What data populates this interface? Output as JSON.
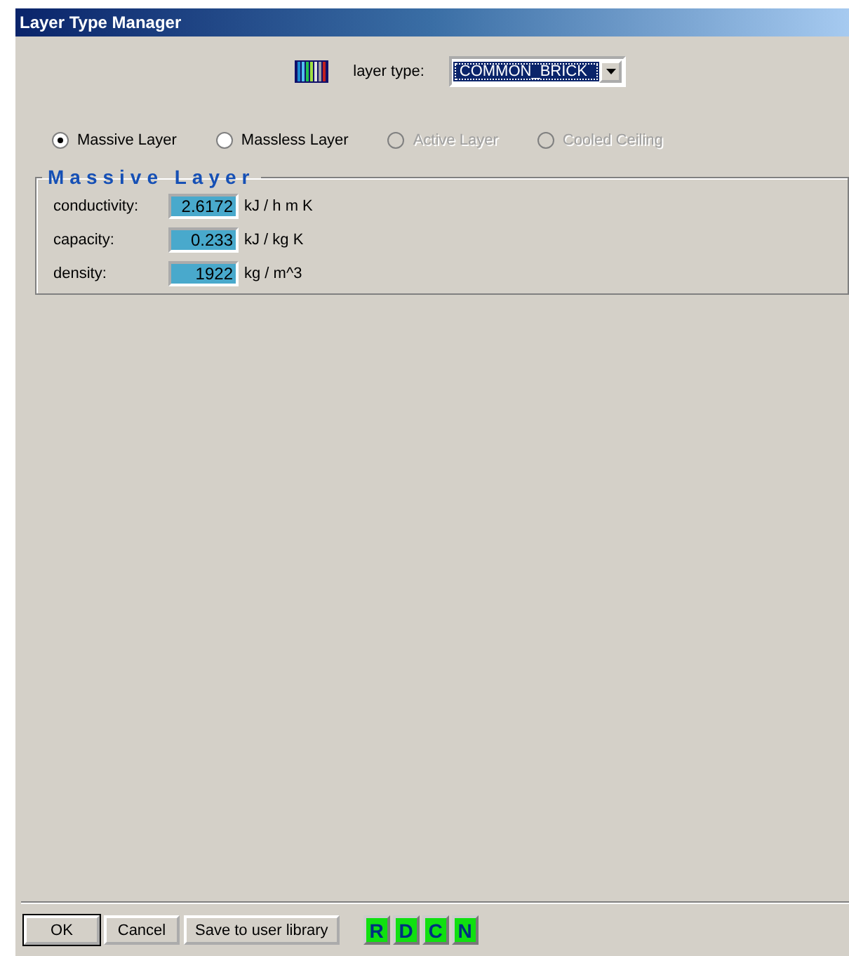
{
  "window": {
    "title": "Layer Type Manager"
  },
  "layer_type": {
    "label": "layer type:",
    "value": "COMMON_BRICK"
  },
  "radios": [
    {
      "label": "Massive Layer",
      "selected": true,
      "disabled": false
    },
    {
      "label": "Massless Layer",
      "selected": false,
      "disabled": false
    },
    {
      "label": "Active Layer",
      "selected": false,
      "disabled": true
    },
    {
      "label": "Cooled Ceiling",
      "selected": false,
      "disabled": true
    }
  ],
  "group": {
    "title": "Massive Layer",
    "fields": [
      {
        "label": "conductivity:",
        "value": "2.6172",
        "unit": "kJ / h m K"
      },
      {
        "label": "capacity:",
        "value": "0.233",
        "unit": "kJ / kg K"
      },
      {
        "label": "density:",
        "value": "1922",
        "unit": "kg / m^3"
      }
    ]
  },
  "buttons": [
    {
      "label": "OK",
      "default": true
    },
    {
      "label": "Cancel",
      "default": false
    },
    {
      "label": "Save to user library",
      "default": false
    }
  ],
  "letter_buttons": [
    "R",
    "D",
    "C",
    "N"
  ]
}
